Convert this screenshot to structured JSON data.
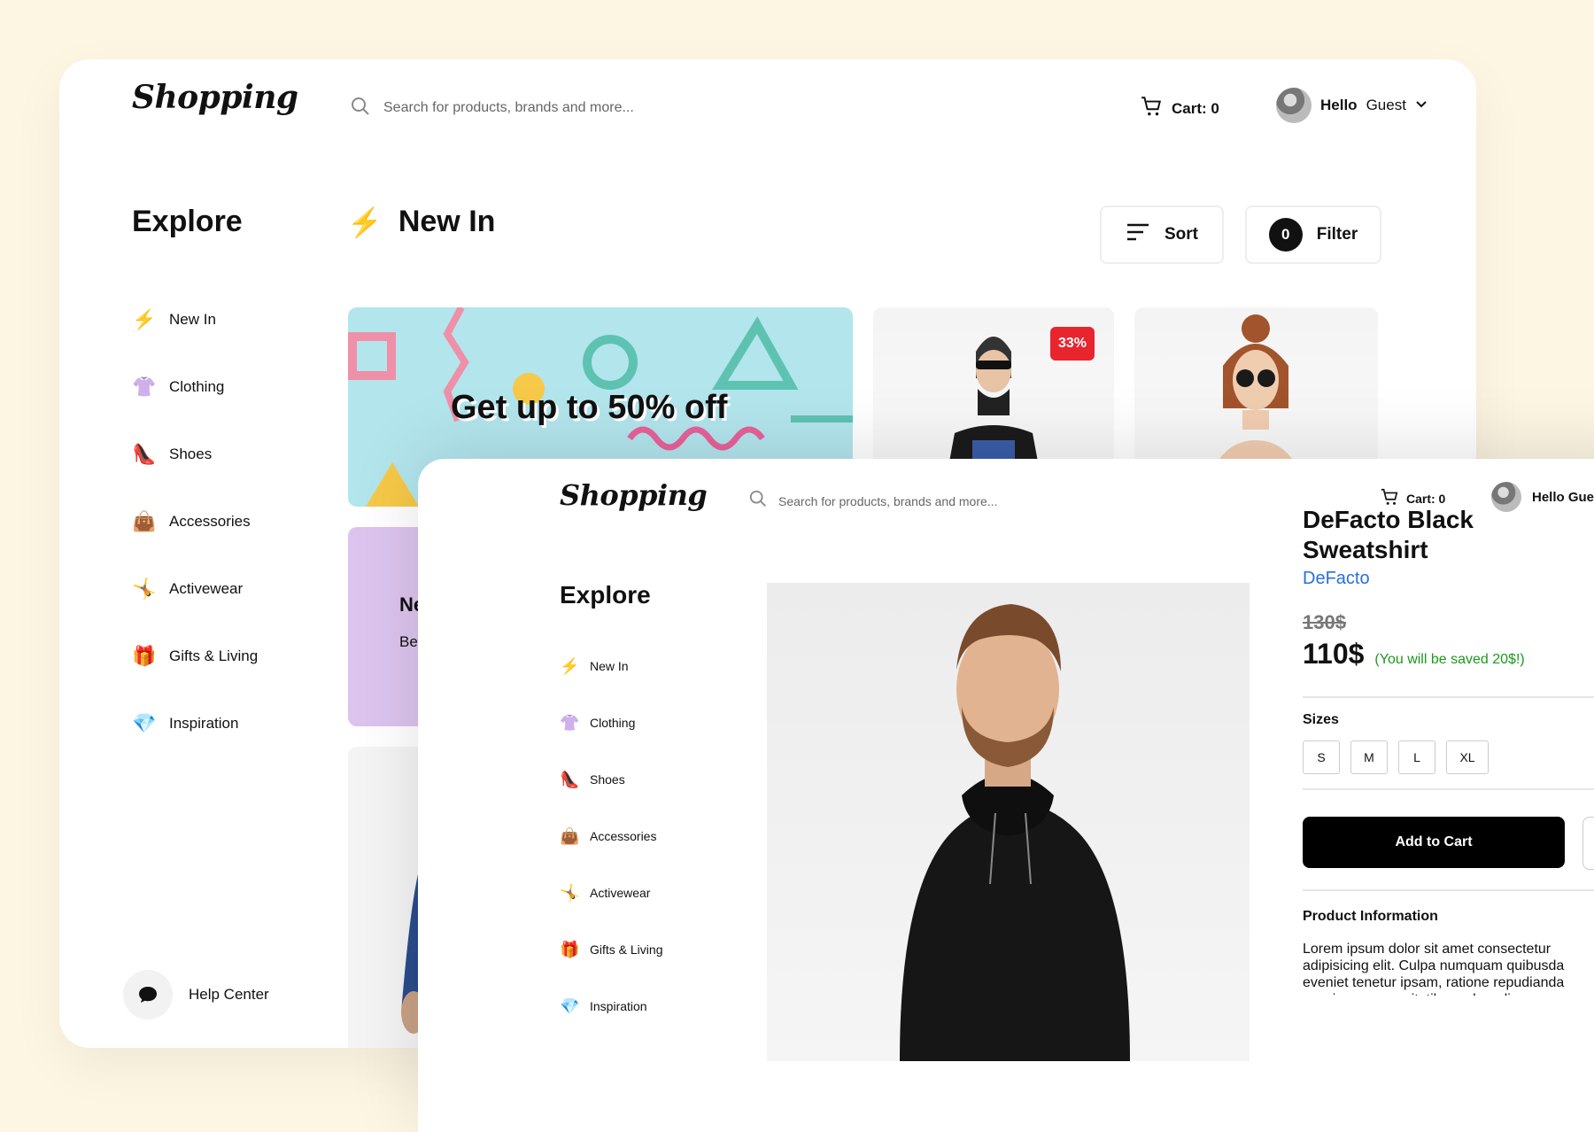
{
  "back": {
    "logo": "Shopping",
    "search_placeholder": "Search for products, brands and more...",
    "cart_label": "Cart: 0",
    "user_greeting": "Hello",
    "user_name": "Guest",
    "explore_title": "Explore",
    "nav": [
      {
        "label": "New In",
        "icon": "lightning-icon"
      },
      {
        "label": "Clothing",
        "icon": "shirt-icon"
      },
      {
        "label": "Shoes",
        "icon": "heel-shoe-icon"
      },
      {
        "label": "Accessories",
        "icon": "handbag-icon"
      },
      {
        "label": "Activewear",
        "icon": "gymnast-icon"
      },
      {
        "label": "Gifts & Living",
        "icon": "gift-icon"
      },
      {
        "label": "Inspiration",
        "icon": "diamond-icon"
      }
    ],
    "section_title": "New In",
    "sort_label": "Sort",
    "filter_label": "Filter",
    "filter_count": "0",
    "promo_text": "Get up to 50% off",
    "discount_badge": "33%",
    "purple_card_title": "Ne",
    "purple_card_sub": "Be",
    "help_center": "Help Center"
  },
  "front": {
    "logo": "Shopping",
    "search_placeholder": "Search for products, brands and more...",
    "cart_label": "Cart: 0",
    "user_label": "Hello Gue",
    "explore_title": "Explore",
    "nav": [
      {
        "label": "New In",
        "icon": "lightning-icon"
      },
      {
        "label": "Clothing",
        "icon": "shirt-icon"
      },
      {
        "label": "Shoes",
        "icon": "heel-shoe-icon"
      },
      {
        "label": "Accessories",
        "icon": "handbag-icon"
      },
      {
        "label": "Activewear",
        "icon": "gymnast-icon"
      },
      {
        "label": "Gifts & Living",
        "icon": "gift-icon"
      },
      {
        "label": "Inspiration",
        "icon": "diamond-icon"
      }
    ],
    "product": {
      "title_line1": "DeFacto Black",
      "title_line2": "Sweatshirt",
      "brand": "DeFacto",
      "old_price": "130$",
      "price": "110$",
      "savings": "(You will be saved 20$!)",
      "sizes_label": "Sizes",
      "sizes": [
        "S",
        "M",
        "L",
        "XL"
      ],
      "add_to_cart": "Add to Cart",
      "info_title": "Product Information",
      "info_text": "Lorem ipsum dolor sit amet consectetur adipisicing elit. Culpa numquam quibusda eveniet tenetur ipsam, ratione repudianda possimus necessitatibus ad modi cumq"
    }
  },
  "colors": {
    "background": "#fdf6e3",
    "accent_black": "#000000",
    "brand_link": "#2a6fdb",
    "savings_green": "#1a9a1a",
    "badge_red": "#e8242f",
    "promo_bg": "#b3e5ed",
    "purple_card": "#dcc4ee"
  }
}
